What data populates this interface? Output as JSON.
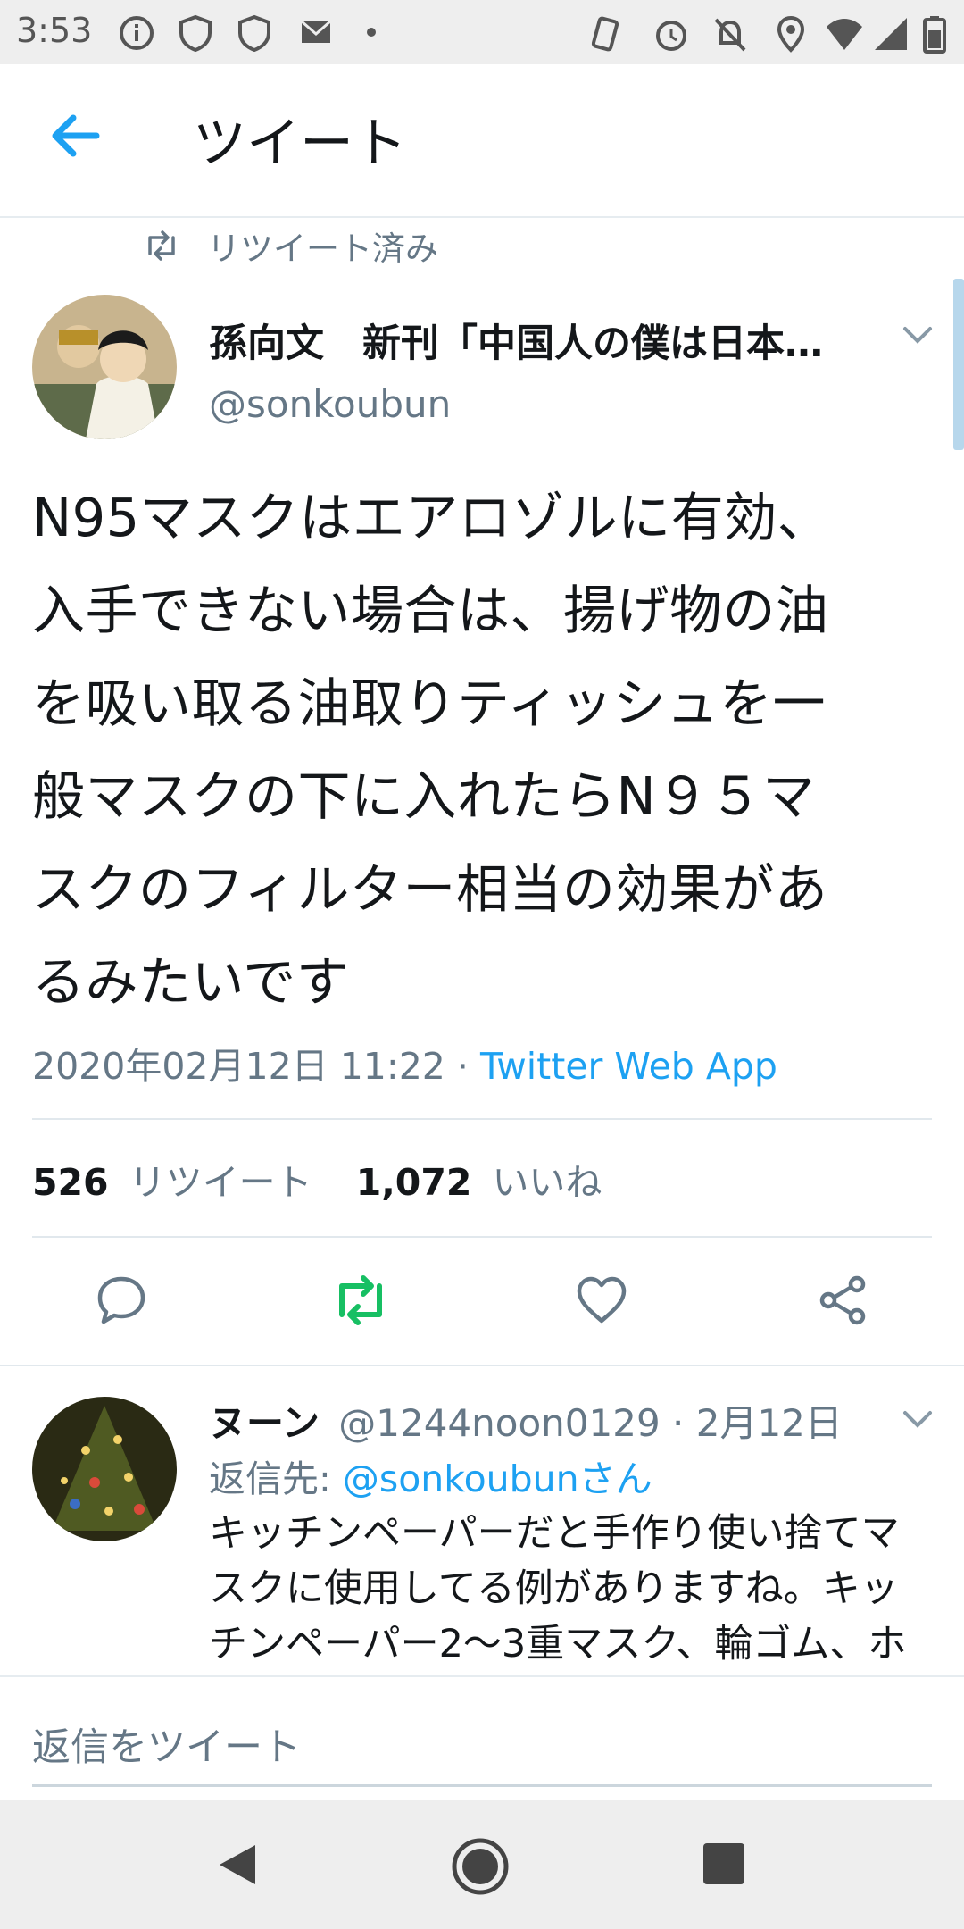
{
  "status_bar": {
    "time": "3:53",
    "icons_left": [
      "info-icon",
      "phone-shield-icon",
      "phone-shield-icon",
      "mail-icon",
      "dot-icon"
    ],
    "icons_right": [
      "nfc-icon",
      "alarm-icon",
      "notifications-off-icon",
      "location-icon",
      "wifi-icon",
      "signal-icon",
      "battery-icon"
    ]
  },
  "app_bar": {
    "title": "ツイート"
  },
  "retweet_banner": {
    "text": "リツイート済み"
  },
  "tweet": {
    "author_name": "孫向文　新刊「中国人の僕は日本…",
    "handle": "@sonkoubun",
    "lines": [
      "N95マスクはエアロゾルに有効、",
      "入手できない場合は、揚げ物の油",
      "を吸い取る油取りティッシュを一",
      "般マスクの下に入れたらN９５マ",
      "スクのフィルター相当の効果があ",
      "るみたいです"
    ],
    "timestamp": "2020年02月12日 11:22",
    "separator": " · ",
    "via": "Twitter Web App",
    "retweet_count": "526",
    "retweet_label": "リツイート",
    "like_count": "1,072",
    "like_label": "いいね"
  },
  "reply": {
    "name": "ヌーン",
    "handle": "@1244noon0129",
    "separator": " · ",
    "date": "2月12日",
    "reply_to_label": "返信先: ",
    "reply_to_user": "@sonkoubunさん",
    "text": "キッチンペーパーだと手作り使い捨てマスクに使用してる例がありますね。キッチンペーパー2〜3重マスク、輪ゴム、ホッチキスで自作しているのが結構ボーダー"
  },
  "compose": {
    "placeholder": "返信をツイート"
  },
  "colors": {
    "accent": "#1da1f2",
    "retweet_green": "#17bf63",
    "muted": "#657786",
    "text": "#14171a"
  }
}
